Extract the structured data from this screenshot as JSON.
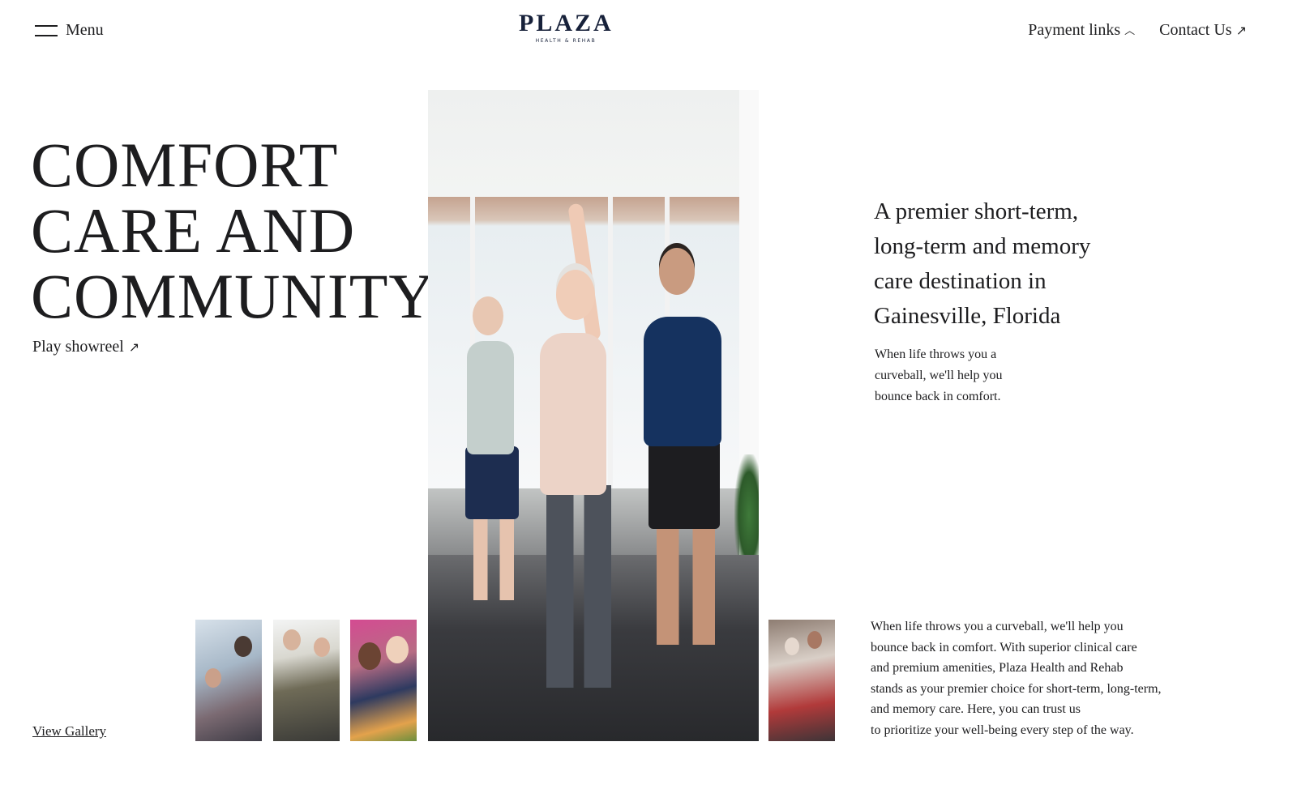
{
  "header": {
    "menu_label": "Menu",
    "logo": {
      "word": "PLAZA",
      "sub": "HEALTH & REHAB"
    },
    "nav": [
      {
        "label": "Payment links",
        "icon": "chevron-up-icon"
      },
      {
        "label": "Contact Us",
        "icon": "arrow-up-right-icon"
      }
    ]
  },
  "hero": {
    "headline": [
      "COMFORT",
      "CARE AND",
      "COMMUNITY"
    ],
    "showreel_label": "Play showreel",
    "gallery_label": "View Gallery"
  },
  "intro": {
    "tagline": "A premier short-term, long-term and memory care destination in Gainesville, Florida",
    "subtag": "When life throws you a curveball, we'll help you bounce back in comfort."
  },
  "about": {
    "body": "When life throws you a curveball, we'll help you\nbounce back in comfort. With superior clinical care\nand premium amenities, Plaza Health and Rehab\nstands as your premier choice for short-term, long-term,\nand memory care. Here, you can trust us\nto prioritize your well-being every step of the way."
  },
  "colors": {
    "text": "#1d1d1f",
    "logo": "#17213a",
    "background": "#ffffff"
  }
}
